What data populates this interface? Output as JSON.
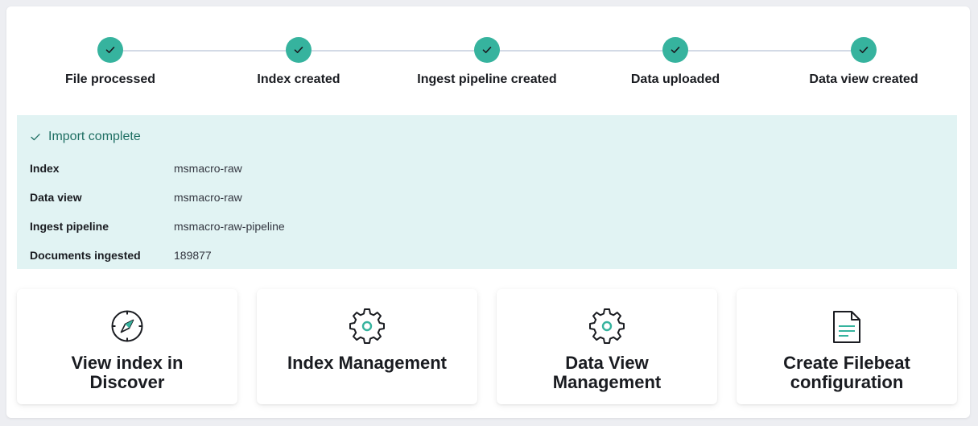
{
  "steps": [
    {
      "label": "File processed",
      "status": "complete"
    },
    {
      "label": "Index created",
      "status": "complete"
    },
    {
      "label": "Ingest pipeline created",
      "status": "complete"
    },
    {
      "label": "Data uploaded",
      "status": "complete"
    },
    {
      "label": "Data view created",
      "status": "complete"
    }
  ],
  "callout": {
    "title": "Import complete",
    "rows": [
      {
        "key": "Index",
        "value": "msmacro-raw"
      },
      {
        "key": "Data view",
        "value": "msmacro-raw"
      },
      {
        "key": "Ingest pipeline",
        "value": "msmacro-raw-pipeline"
      },
      {
        "key": "Documents ingested",
        "value": "189877"
      }
    ]
  },
  "cards": [
    {
      "title": "View index in Discover",
      "icon": "compass-icon"
    },
    {
      "title": "Index Management",
      "icon": "gear-icon"
    },
    {
      "title": "Data View Management",
      "icon": "gear-icon"
    },
    {
      "title": "Create Filebeat configuration",
      "icon": "document-icon"
    }
  ],
  "colors": {
    "step_complete": "#36b39e",
    "callout_bg": "#e1f3f3",
    "callout_title": "#1f6f63"
  }
}
